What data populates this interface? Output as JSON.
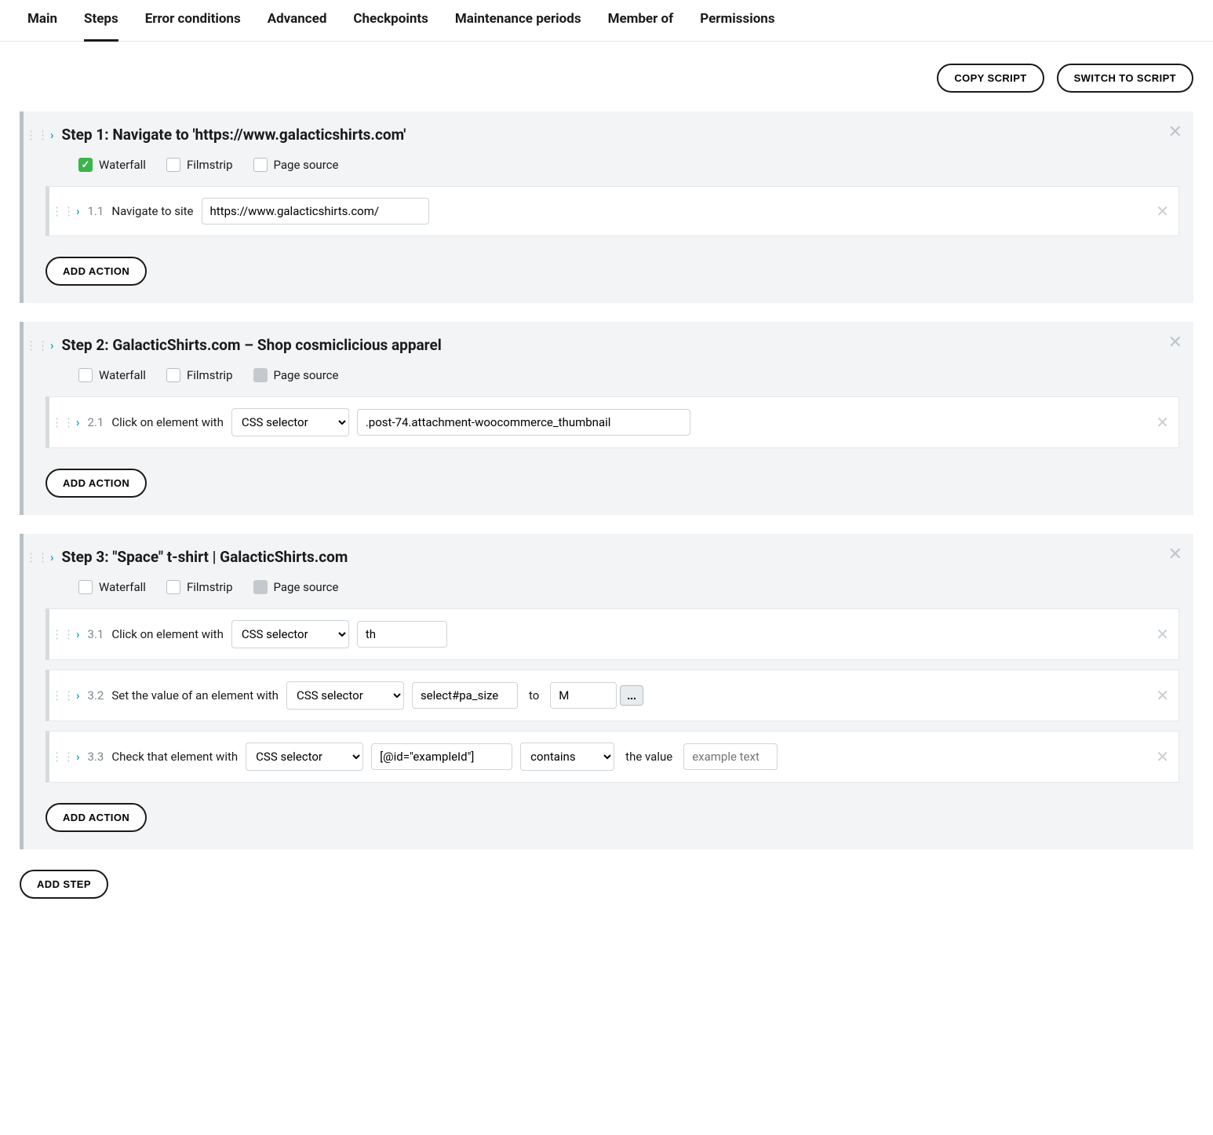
{
  "tabs": [
    "Main",
    "Steps",
    "Error conditions",
    "Advanced",
    "Checkpoints",
    "Maintenance periods",
    "Member of",
    "Permissions"
  ],
  "active_tab": "Steps",
  "buttons": {
    "copy_script": "COPY SCRIPT",
    "switch_to_script": "SWITCH TO SCRIPT",
    "add_action": "ADD ACTION",
    "add_step": "ADD STEP",
    "ellipsis": "..."
  },
  "option_labels": {
    "waterfall": "Waterfall",
    "filmstrip": "Filmstrip",
    "page_source": "Page source"
  },
  "action_labels": {
    "navigate": "Navigate to site",
    "click": "Click on element with",
    "set_value": "Set the value of an element with",
    "check": "Check that element with",
    "to": "to",
    "the_value": "the value"
  },
  "selectors": {
    "css": "CSS selector",
    "contains": "contains"
  },
  "steps": [
    {
      "title": "Step 1: Navigate to 'https://www.galacticshirts.com'",
      "options": {
        "waterfall": "checked",
        "filmstrip": "off",
        "page_source": "off"
      },
      "actions": [
        {
          "num": "1.1",
          "type": "navigate",
          "url": "https://www.galacticshirts.com/"
        }
      ]
    },
    {
      "title": "Step 2: GalacticShirts.com – Shop cosmiclicious apparel",
      "options": {
        "waterfall": "off",
        "filmstrip": "off",
        "page_source": "neutral"
      },
      "actions": [
        {
          "num": "2.1",
          "type": "click",
          "selector_type": "CSS selector",
          "selector": ".post-74.attachment-woocommerce_thumbnail"
        }
      ]
    },
    {
      "title": "Step 3: \"Space\" t-shirt | GalacticShirts.com",
      "options": {
        "waterfall": "off",
        "filmstrip": "off",
        "page_source": "neutral"
      },
      "actions": [
        {
          "num": "3.1",
          "type": "click",
          "selector_type": "CSS selector",
          "selector": "th"
        },
        {
          "num": "3.2",
          "type": "set_value",
          "selector_type": "CSS selector",
          "selector": "select#pa_size",
          "value": "M"
        },
        {
          "num": "3.3",
          "type": "check",
          "selector_type": "CSS selector",
          "selector": "[@id=\"exampleId\"]",
          "op": "contains",
          "value_placeholder": "example text"
        }
      ]
    }
  ]
}
